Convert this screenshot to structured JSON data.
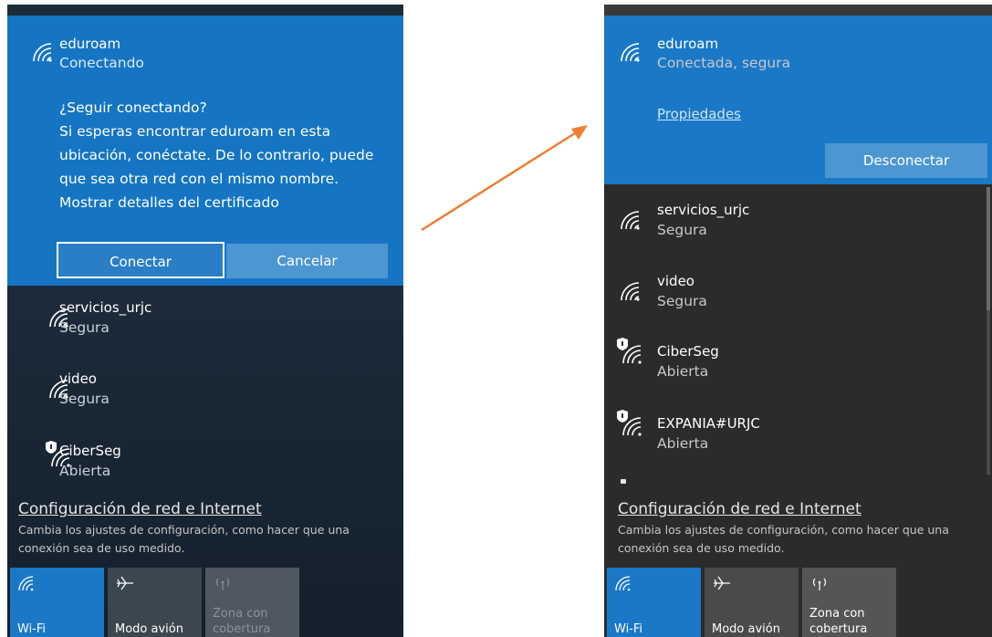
{
  "colors": {
    "accent_blue": "#1575c3",
    "arrow_orange": "#ef7d32"
  },
  "before": {
    "selected_network": {
      "name": "eduroam",
      "status": "Conectando",
      "icon": "wifi-icon"
    },
    "prompt": {
      "lines": [
        "¿Seguir conectando?",
        "Si esperas encontrar eduroam en esta",
        "ubicación, conéctate. De lo contrario, puede",
        "que sea otra red con el mismo nombre.",
        "Mostrar detalles del certificado"
      ]
    },
    "buttons": {
      "connect": "Conectar",
      "cancel": "Cancelar"
    },
    "networks": [
      {
        "name": "servicios_urjc",
        "status": "Segura",
        "icon": "wifi-icon"
      },
      {
        "name": "video",
        "status": "Segura",
        "icon": "wifi-icon"
      },
      {
        "name": "CiberSeg",
        "status": "Abierta",
        "icon": "wifi-shield-icon"
      }
    ],
    "settings": {
      "link": "Configuración de red e Internet",
      "desc_line1": "Cambia los ajustes de configuración, como hacer que una",
      "desc_line2": "conexión sea de uso medido."
    },
    "tiles": {
      "wifi": "Wi-Fi",
      "airplane": "Modo avión",
      "hotspot_line1": "Zona con",
      "hotspot_line2": "cobertura"
    }
  },
  "after": {
    "selected_network": {
      "name": "eduroam",
      "status": "Conectada, segura",
      "icon": "wifi-icon"
    },
    "properties_link": "Propiedades",
    "buttons": {
      "disconnect": "Desconectar"
    },
    "networks": [
      {
        "name": "servicios_urjc",
        "status": "Segura",
        "icon": "wifi-icon"
      },
      {
        "name": "video",
        "status": "Segura",
        "icon": "wifi-icon"
      },
      {
        "name": "CiberSeg",
        "status": "Abierta",
        "icon": "wifi-shield-icon"
      },
      {
        "name": "EXPANIA#URJC",
        "status": "Abierta",
        "icon": "wifi-shield-icon"
      }
    ],
    "settings": {
      "link": "Configuración de red e Internet",
      "desc_line1": "Cambia los ajustes de configuración, como hacer que una",
      "desc_line2": "conexión sea de uso medido."
    },
    "tiles": {
      "wifi": "Wi-Fi",
      "airplane": "Modo avión",
      "hotspot_line1": "Zona con",
      "hotspot_line2": "cobertura"
    }
  }
}
